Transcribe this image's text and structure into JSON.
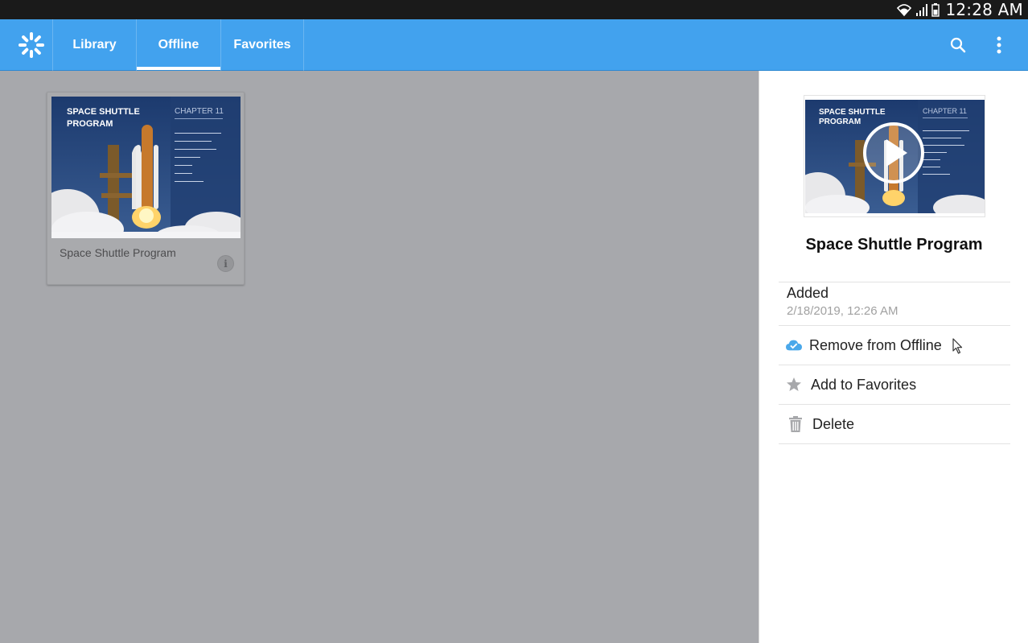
{
  "status_bar": {
    "time": "12:28 AM",
    "icons": [
      "wifi-icon",
      "signal-icon",
      "battery-icon"
    ]
  },
  "app_bar": {
    "logo": "kaltura-logo-icon",
    "tabs": [
      {
        "label": "Library",
        "active": false
      },
      {
        "label": "Offline",
        "active": true
      },
      {
        "label": "Favorites",
        "active": false
      }
    ],
    "actions": [
      "search-icon",
      "overflow-menu-icon"
    ]
  },
  "grid": {
    "items": [
      {
        "title": "Space Shuttle Program",
        "thumbnail": {
          "heading_line1": "SPACE SHUTTLE",
          "heading_line2": "PROGRAM",
          "chapter": "CHAPTER 11"
        },
        "info_label": "i"
      }
    ]
  },
  "details_panel": {
    "title": "Space Shuttle Program",
    "preview": {
      "heading_line1": "SPACE SHUTTLE",
      "heading_line2": "PROGRAM",
      "chapter": "CHAPTER 11",
      "play_icon": "play-icon"
    },
    "added_label": "Added",
    "added_date": "2/18/2019, 12:26 AM",
    "actions": [
      {
        "label": "Remove from Offline",
        "icon": "cloud-check-icon"
      },
      {
        "label": "Add to Favorites",
        "icon": "star-icon"
      },
      {
        "label": "Delete",
        "icon": "trash-icon"
      }
    ]
  },
  "colors": {
    "app_bar": "#42a2ee",
    "status_bar": "#1a1a1a",
    "overlay_gray": "#a7a8ac",
    "cloud_icon": "#4aa8ea"
  }
}
